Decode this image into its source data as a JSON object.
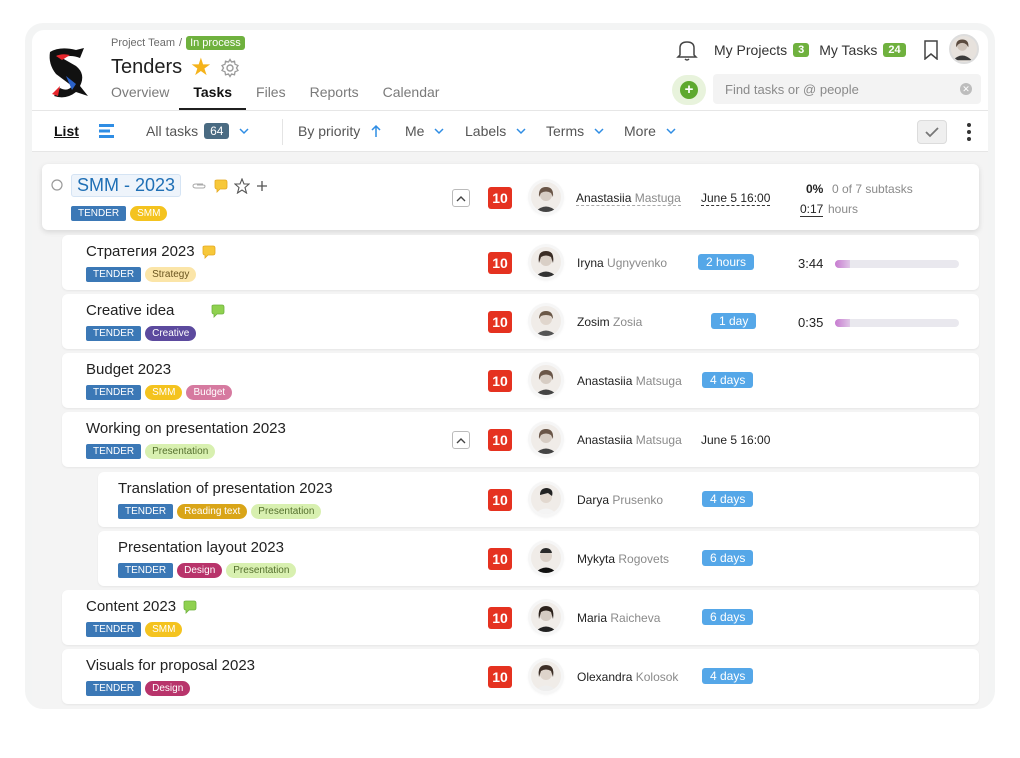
{
  "header": {
    "breadcrumb": "Project Team",
    "breadcrumb_sep": "/",
    "status": "In process",
    "title": "Tenders",
    "tabs": [
      "Overview",
      "Tasks",
      "Files",
      "Reports",
      "Calendar"
    ],
    "active_tab": "Tasks",
    "my_projects_label": "My Projects",
    "my_projects_count": "3",
    "my_tasks_label": "My Tasks",
    "my_tasks_count": "24",
    "search_placeholder": "Find tasks or @ people"
  },
  "toolbar": {
    "view": "List",
    "all_tasks": "All tasks",
    "all_tasks_count": "64",
    "sort": "By priority",
    "me": "Me",
    "labels": "Labels",
    "terms": "Terms",
    "more": "More"
  },
  "parent_task": {
    "name": "SMM - 2023",
    "tags": [
      "TENDER",
      "SMM"
    ],
    "priority": "10",
    "assignee_first": "Anastasiia",
    "assignee_last": "Mastuga",
    "due": "June 5 16:00",
    "percent": "0%",
    "subtasks": "0 of 7 subtasks",
    "hours_value": "0:17",
    "hours_label": "hours"
  },
  "tasks": [
    {
      "name": "Стратегия 2023",
      "tags": [
        "TENDER",
        "Strategy"
      ],
      "priority": "10",
      "first": "Iryna",
      "last": "Ugnyvenko",
      "duration": "2 hours",
      "time": "3:44",
      "progress": 0.12
    },
    {
      "name": "Creative idea",
      "tags": [
        "TENDER",
        "Creative"
      ],
      "priority": "10",
      "first": "Zosim",
      "last": "Zosia",
      "duration": "1 day",
      "time": "0:35",
      "progress": 0.12
    },
    {
      "name": "Budget 2023",
      "tags": [
        "TENDER",
        "SMM",
        "Budget"
      ],
      "priority": "10",
      "first": "Anastasiia",
      "last": "Matsuga",
      "duration": "4 days"
    },
    {
      "name": "Working on presentation 2023",
      "tags": [
        "TENDER",
        "Presentation"
      ],
      "priority": "10",
      "first": "Anastasiia",
      "last": "Matsuga",
      "due": "June 5 16:00"
    },
    {
      "name": "Translation of presentation 2023",
      "tags": [
        "TENDER",
        "Reading text",
        "Presentation"
      ],
      "priority": "10",
      "first": "Darya",
      "last": "Prusenko",
      "duration": "4 days"
    },
    {
      "name": "Presentation layout 2023",
      "tags": [
        "TENDER",
        "Design",
        "Presentation"
      ],
      "priority": "10",
      "first": "Mykyta",
      "last": "Rogovets",
      "duration": "6 days"
    },
    {
      "name": "Content 2023",
      "tags": [
        "TENDER",
        "SMM"
      ],
      "priority": "10",
      "first": "Maria",
      "last": "Raicheva",
      "duration": "6 days"
    },
    {
      "name": "Visuals for proposal 2023",
      "tags": [
        "TENDER",
        "Design"
      ],
      "priority": "10",
      "first": "Olexandra",
      "last": "Kolosok",
      "duration": "4 days"
    }
  ],
  "colors": {
    "accent_green": "#6fb13e",
    "priority_red": "#e53220",
    "duration_blue": "#55a7e8",
    "tender_blue": "#3b78b6"
  }
}
